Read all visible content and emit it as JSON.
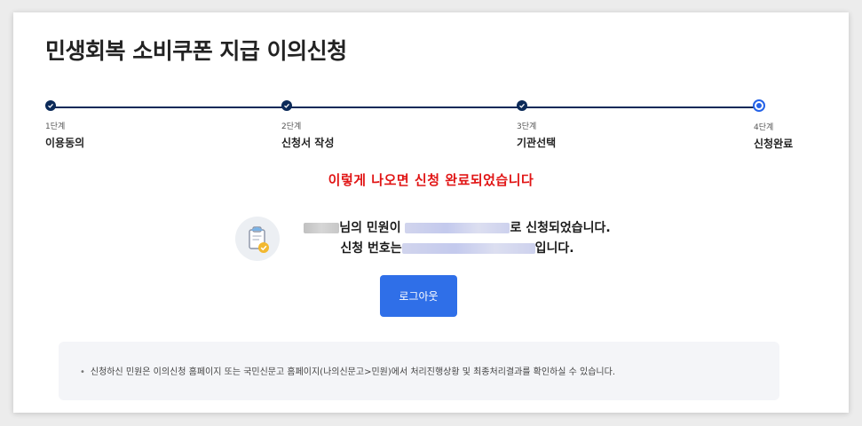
{
  "page": {
    "title": "민생회복 소비쿠폰 지급 이의신청",
    "notice": "이렇게 나오면 신청 완료되었습니다"
  },
  "steps": [
    {
      "num": "1단계",
      "name": "이용동의",
      "state": "done"
    },
    {
      "num": "2단계",
      "name": "신청서 작성",
      "state": "done"
    },
    {
      "num": "3단계",
      "name": "기관선택",
      "state": "done"
    },
    {
      "num": "4단계",
      "name": "신청완료",
      "state": "current"
    }
  ],
  "result": {
    "line1_part1": "님의 민원이",
    "line1_part2": "로 신청되었습니다.",
    "line2_part1": "신청 번호는",
    "line2_part2": "입니다."
  },
  "buttons": {
    "logout_label": "로그아웃"
  },
  "info": {
    "text": "신청하신 민원은 이의신청 홈페이지 또는 국민신문고 홈페이지(나의신문고>민원)에서 처리진행상황 및 최종처리결과를 확인하실 수 있습니다."
  },
  "colors": {
    "step_done": "#0b2a59",
    "step_current": "#2563e8",
    "notice": "#e11515",
    "button": "#2f6fe8"
  },
  "icons": {
    "step_done": "check-icon",
    "result": "clipboard-check-icon"
  }
}
